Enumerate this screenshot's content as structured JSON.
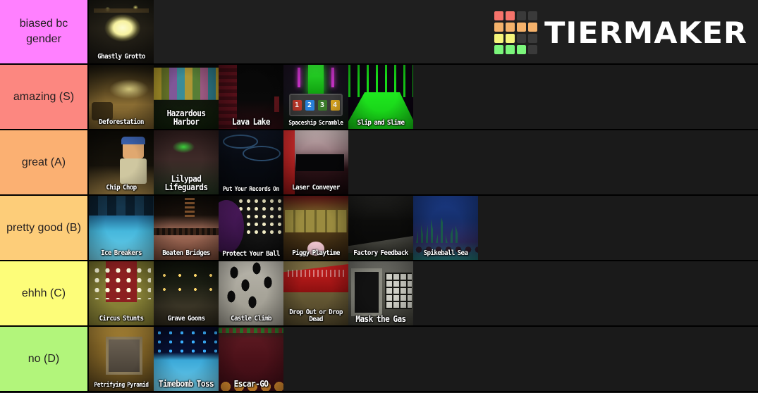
{
  "app": {
    "brand": "TIERMAKER",
    "logo_colors": [
      "#f5736b",
      "#f5736b",
      "#3a3a3a",
      "#3a3a3a",
      "#f5b26b",
      "#f5b26b",
      "#f5b26b",
      "#f5b26b",
      "#f5f57b",
      "#f5f57b",
      "#3a3a3a",
      "#3a3a3a",
      "#7bf57b",
      "#7bf57b",
      "#7bf57b",
      "#3a3a3a"
    ],
    "background": "#1a1a1a",
    "header_background": "#1f1f1f"
  },
  "tiers": [
    {
      "label": "biased bc gender",
      "color": "#ff80ff",
      "items": [
        {
          "name": "Ghastly Grotto",
          "art": "ghastly",
          "cap_size": "sm"
        }
      ]
    },
    {
      "label": "amazing (S)",
      "color": "#fc8780",
      "items": [
        {
          "name": "Deforestation",
          "art": "deforest",
          "cap_size": "sm"
        },
        {
          "name": "Hazardous Harbor",
          "art": "hazard",
          "cap_size": "lg"
        },
        {
          "name": "Lava Lake",
          "art": "lava",
          "cap_size": "lg"
        },
        {
          "name": "Spaceship Scramble",
          "art": "spaceship",
          "cap_size": "xs"
        },
        {
          "name": "Slip and Slime",
          "art": "slip",
          "cap_size": "sm"
        }
      ]
    },
    {
      "label": "great (A)",
      "color": "#fbb072",
      "items": [
        {
          "name": "Chip Chop",
          "art": "chipchop",
          "cap_size": "sm"
        },
        {
          "name": "Lilypad Lifeguards",
          "art": "lilypad",
          "cap_size": "lg"
        },
        {
          "name": "Put Your Records On",
          "art": "records",
          "cap_size": "xs"
        },
        {
          "name": "Laser Conveyer",
          "art": "laser",
          "cap_size": "sm"
        }
      ]
    },
    {
      "label": "pretty good (B)",
      "color": "#fdcd79",
      "items": [
        {
          "name": "Ice Breakers",
          "art": "ice",
          "cap_size": "sm"
        },
        {
          "name": "Beaten Bridges",
          "art": "beaten",
          "cap_size": "sm"
        },
        {
          "name": "Protect Your Ball",
          "art": "protect",
          "cap_size": "sm"
        },
        {
          "name": "Piggy Playtime",
          "art": "piggy",
          "cap_size": "sm"
        },
        {
          "name": "Factory Feedback",
          "art": "factory",
          "cap_size": "sm"
        },
        {
          "name": "Spikeball Sea",
          "art": "spikeball",
          "cap_size": "sm"
        }
      ]
    },
    {
      "label": "ehhh (C)",
      "color": "#fdfd79",
      "items": [
        {
          "name": "Circus Stunts",
          "art": "circus",
          "cap_size": "sm"
        },
        {
          "name": "Grave Goons",
          "art": "grave",
          "cap_size": "sm"
        },
        {
          "name": "Castle Climb",
          "art": "castle",
          "cap_size": "sm"
        },
        {
          "name": "Drop Out or Drop Dead",
          "art": "dropout",
          "cap_size": "sm"
        },
        {
          "name": "Mask the Gas",
          "art": "mask",
          "cap_size": "lg"
        }
      ]
    },
    {
      "label": "no (D)",
      "color": "#b2f57b",
      "items": [
        {
          "name": "Petrifying Pyramid",
          "art": "pyramid",
          "cap_size": "xs"
        },
        {
          "name": "Timebomb Toss",
          "art": "timebomb",
          "cap_size": "lg"
        },
        {
          "name": "Escar-GO",
          "art": "escargo",
          "cap_size": "lg"
        }
      ]
    }
  ],
  "spaceship_pad": [
    {
      "label": "1",
      "color": "#c0392b"
    },
    {
      "label": "2",
      "color": "#2980d9"
    },
    {
      "label": "3",
      "color": "#3a7a2a"
    },
    {
      "label": "4",
      "color": "#d9a520"
    }
  ]
}
